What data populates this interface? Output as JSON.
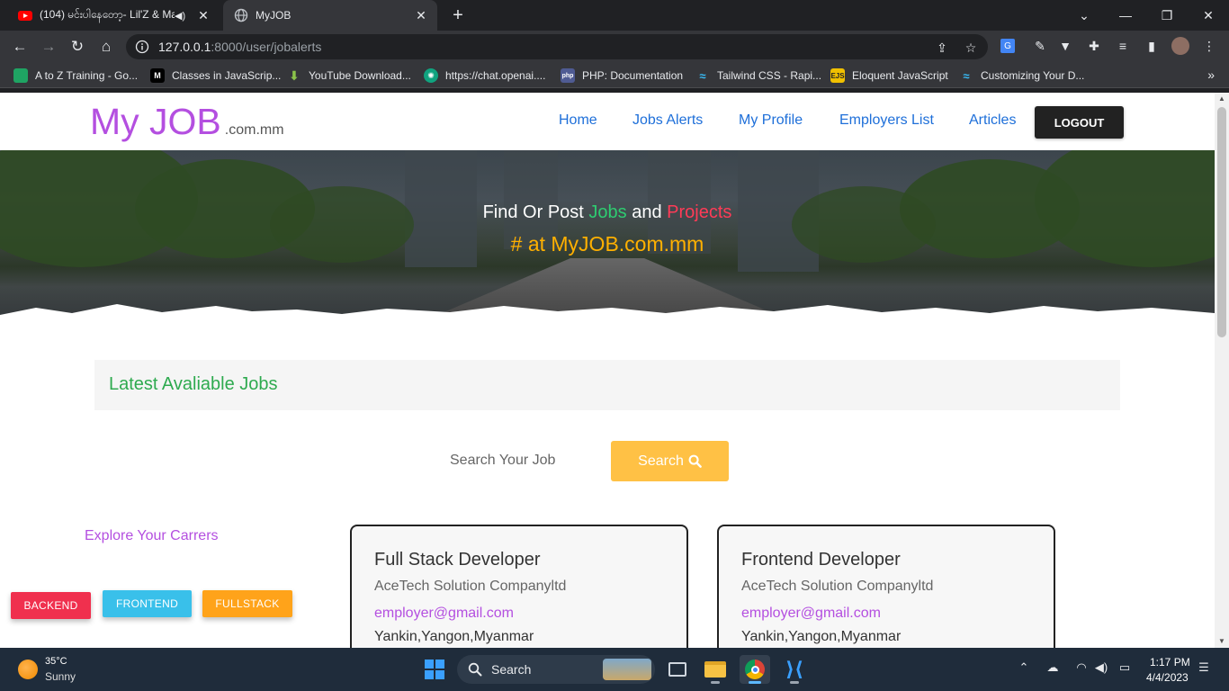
{
  "browser": {
    "tabs": [
      {
        "title": "(104) မင်းပါနေတော့- Lil'Z & Mar",
        "active": false,
        "audio": true
      },
      {
        "title": "MyJOB",
        "active": true
      }
    ],
    "url_host": "127.0.0.1",
    "url_path": ":8000/user/jobalerts",
    "bookmarks": [
      {
        "label": "A to Z Training - Go...",
        "icon": "google-drive-icon",
        "color": "#1fa463"
      },
      {
        "label": "Classes in JavaScrip...",
        "icon": "medium-icon",
        "color": "#000000"
      },
      {
        "label": "YouTube Download...",
        "icon": "download-arrow-icon",
        "color": "#8bc34a"
      },
      {
        "label": "https://chat.openai....",
        "icon": "openai-icon",
        "color": "#10a37f"
      },
      {
        "label": "PHP: Documentation",
        "icon": "php-icon",
        "color": "#4f5b93"
      },
      {
        "label": "Tailwind CSS - Rapi...",
        "icon": "tailwind-icon",
        "color": "#38bdf8"
      },
      {
        "label": "Eloquent JavaScript",
        "icon": "ejs-icon",
        "color": "#f0c000"
      },
      {
        "label": "Customizing Your D...",
        "icon": "tailwind-icon",
        "color": "#38bdf8"
      }
    ]
  },
  "site": {
    "brand": "My JOB",
    "brand_tld": ".com.mm",
    "nav": [
      "Home",
      "Jobs Alerts",
      "My Profile",
      "Employers List",
      "Articles"
    ],
    "logout_label": "LOGOUT",
    "hero": {
      "line1_prefix": "Find Or Post ",
      "line1_jobs": "Jobs",
      "line1_and": " and ",
      "line1_projects": "Projects",
      "line2": "# at MyJOB.com.mm"
    },
    "latest_heading": "Latest Avaliable Jobs",
    "search": {
      "placeholder": "Search Your Job",
      "button_label": "Search"
    },
    "explore_label": "Explore Your Carrers",
    "categories": [
      {
        "label": "BACKEND",
        "color": "#f0304e"
      },
      {
        "label": "FRONTEND",
        "color": "#39c0ea"
      },
      {
        "label": "FULLSTACK",
        "color": "#ffa31a"
      }
    ],
    "jobs": [
      {
        "title": "Full Stack Developer",
        "company": "AceTech Solution Companyltd",
        "email": "employer@gmail.com",
        "location": "Yankin,Yangon,Myanmar"
      },
      {
        "title": "Frontend Developer",
        "company": "AceTech Solution Companyltd",
        "email": "employer@gmail.com",
        "location": "Yankin,Yangon,Myanmar"
      }
    ]
  },
  "taskbar": {
    "weather_temp": "35°C",
    "weather_desc": "Sunny",
    "search_label": "Search",
    "time": "1:17 PM",
    "date": "4/4/2023"
  }
}
